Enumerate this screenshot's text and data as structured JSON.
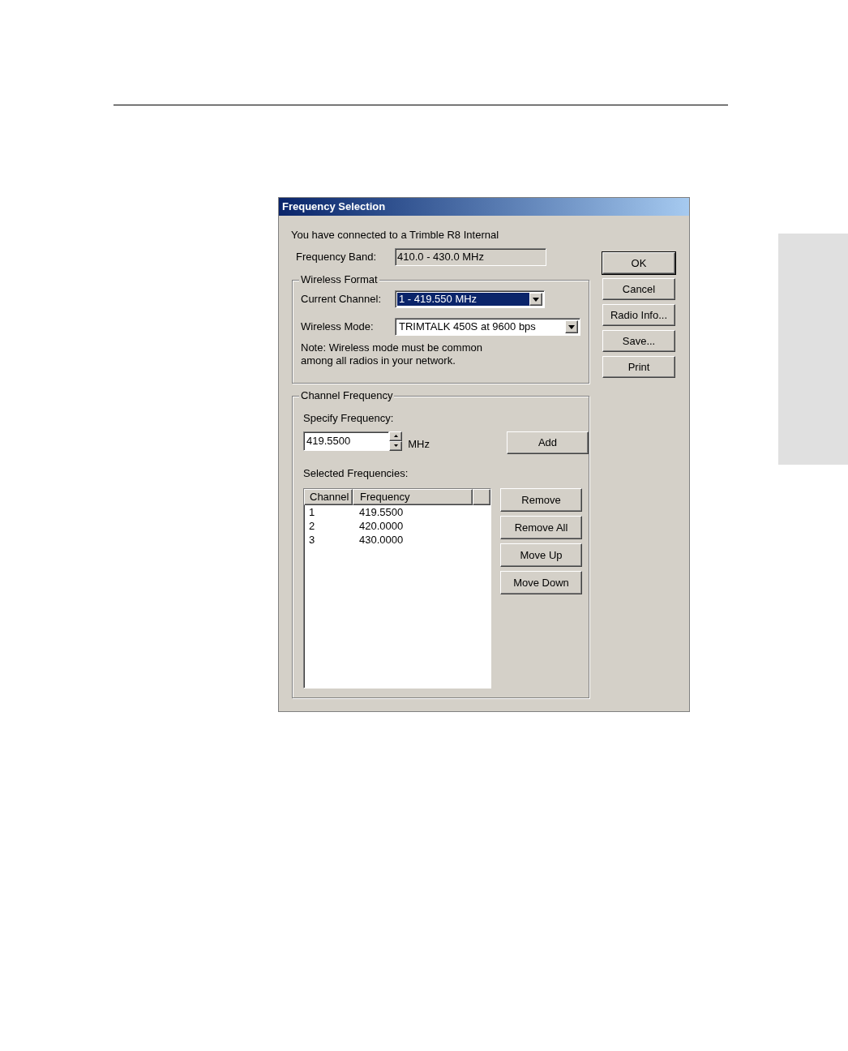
{
  "dialog": {
    "title": "Frequency Selection",
    "message": "You have connected to a Trimble R8 Internal",
    "frequency_band": {
      "label": "Frequency Band:",
      "value": "410.0 - 430.0 MHz"
    },
    "wireless_format": {
      "title": "Wireless Format",
      "current_channel": {
        "label": "Current Channel:",
        "value": "1 - 419.550 MHz",
        "focused": true
      },
      "wireless_mode": {
        "label": "Wireless Mode:",
        "value": "TRIMTALK 450S at 9600 bps",
        "focused": false
      },
      "note": "Note: Wireless mode must be common\namong all radios in your network."
    },
    "channel_frequency": {
      "title": "Channel Frequency",
      "specify_label": "Specify Frequency:",
      "frequency_value": "419.5500",
      "unit": "MHz",
      "add_button": "Add",
      "selected_label": "Selected Frequencies:",
      "columns": [
        "Channel",
        "Frequency"
      ],
      "rows": [
        {
          "channel": "1",
          "frequency": "419.5500"
        },
        {
          "channel": "2",
          "frequency": "420.0000"
        },
        {
          "channel": "3",
          "frequency": "430.0000"
        }
      ],
      "list_buttons": [
        "Remove",
        "Remove All",
        "Move Up",
        "Move Down"
      ]
    },
    "buttons": [
      {
        "label": "OK",
        "default": true
      },
      {
        "label": "Cancel",
        "default": false
      },
      {
        "label": "Radio Info...",
        "default": false
      },
      {
        "label": "Save...",
        "default": false
      },
      {
        "label": "Print",
        "default": false
      }
    ]
  }
}
